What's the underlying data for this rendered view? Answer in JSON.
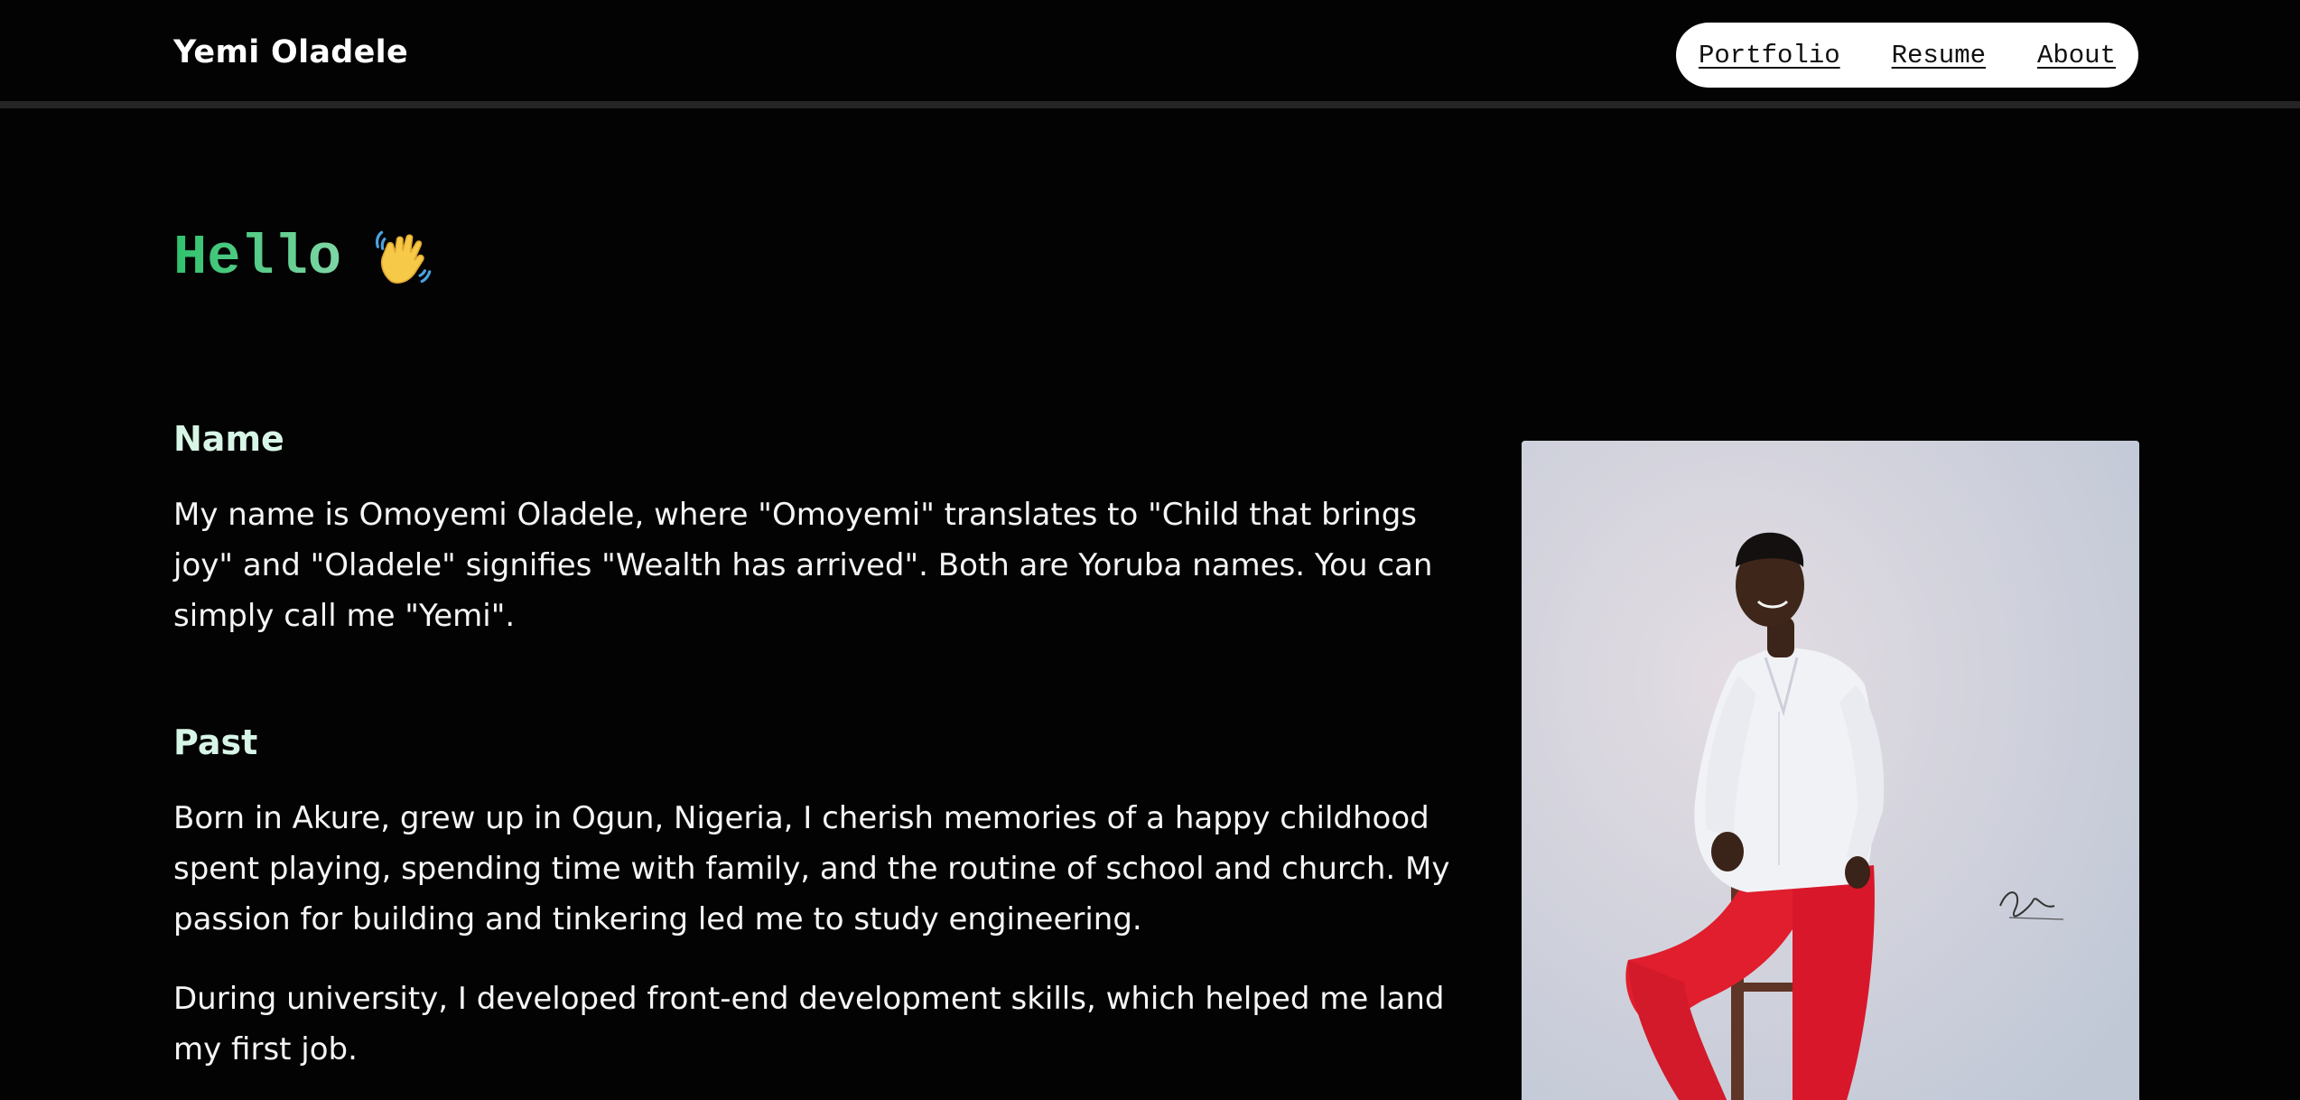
{
  "header": {
    "brand": "Yemi Oladele",
    "nav": [
      {
        "label": "Portfolio"
      },
      {
        "label": "Resume"
      },
      {
        "label": "About"
      }
    ]
  },
  "hero": {
    "greeting": "Hello",
    "emoji_icon": "waving-hand-icon"
  },
  "sections": {
    "name": {
      "title": "Name",
      "text": "My name is Omoyemi Oladele, where \"Omoyemi\" translates to \"Child that brings joy\" and \"Oladele\" signifies \"Wealth has arrived\". Both are Yoruba names. You can simply call me \"Yemi\"."
    },
    "past": {
      "title": "Past",
      "paragraphs": [
        "Born in Akure, grew up in Ogun, Nigeria, I cherish memories of a happy childhood spent playing, spending time with family, and the routine of school and church. My passion for building and tinkering led me to study engineering.",
        "During university, I developed front-end development skills, which helped me land my first job."
      ]
    }
  },
  "colors": {
    "background": "#030303",
    "accent_green": "#2fc26c",
    "heading_mint": "#d7f5e6",
    "nav_pill": "#ffffff"
  }
}
